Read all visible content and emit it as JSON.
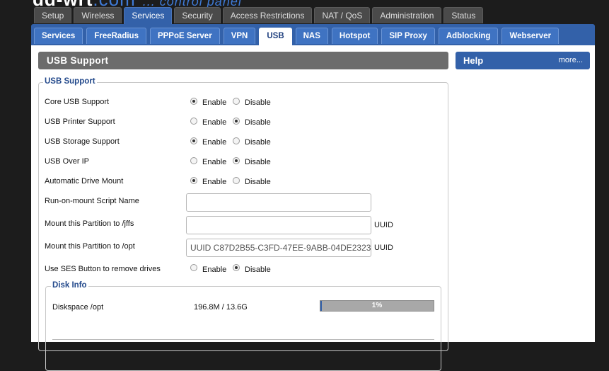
{
  "logo": {
    "brand": "dd-wrt",
    "brand_suffix": ".com",
    "tagline": "... control panel"
  },
  "main_tabs": [
    "Setup",
    "Wireless",
    "Services",
    "Security",
    "Access Restrictions",
    "NAT / QoS",
    "Administration",
    "Status"
  ],
  "main_active": "Services",
  "sub_tabs": [
    "Services",
    "FreeRadius",
    "PPPoE Server",
    "VPN",
    "USB",
    "NAS",
    "Hotspot",
    "SIP Proxy",
    "Adblocking",
    "Webserver"
  ],
  "sub_active": "USB",
  "section_title": "USB Support",
  "help": {
    "title": "Help",
    "more": "more..."
  },
  "fieldset_legend": "USB Support",
  "options": [
    {
      "label": "Core USB Support",
      "enable": "Enable",
      "disable": "Disable",
      "selected": "enable"
    },
    {
      "label": "USB Printer Support",
      "enable": "Enable",
      "disable": "Disable",
      "selected": "disable"
    },
    {
      "label": "USB Storage Support",
      "enable": "Enable",
      "disable": "Disable",
      "selected": "enable"
    },
    {
      "label": "USB Over IP",
      "enable": "Enable",
      "disable": "Disable",
      "selected": "disable"
    },
    {
      "label": "Automatic Drive Mount",
      "enable": "Enable",
      "disable": "Disable",
      "selected": "enable"
    }
  ],
  "script_name": {
    "label": "Run-on-mount Script Name",
    "value": ""
  },
  "mount_jffs": {
    "label": "Mount this Partition to /jffs",
    "value": "",
    "suffix": "UUID"
  },
  "mount_opt": {
    "label": "Mount this Partition to /opt",
    "value": "UUID C87D2B55-C3FD-47EE-9ABB-04DE2323",
    "suffix": "UUID"
  },
  "ses_button": {
    "label": "Use SES Button to remove drives",
    "enable": "Enable",
    "disable": "Disable",
    "selected": "disable"
  },
  "disk_info": {
    "legend": "Disk Info",
    "label": "Diskspace /opt",
    "value": "196.8M / 13.6G",
    "percent_text": "1%",
    "percent": 1
  },
  "colors": {
    "accent": "#3361a9",
    "section_bar": "#6c6c6c"
  }
}
